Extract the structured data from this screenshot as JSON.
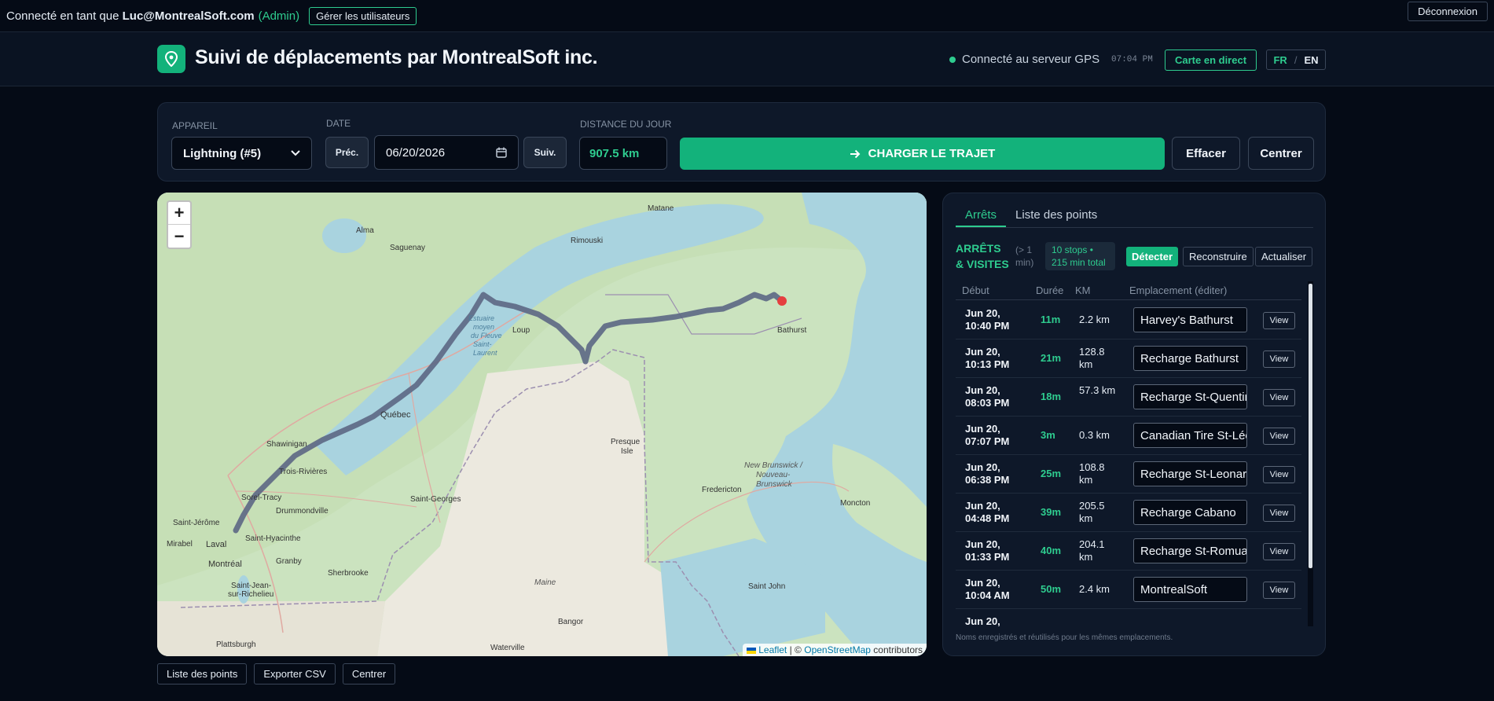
{
  "topbar": {
    "connected_prefix": "Connecté en tant que",
    "user_email": "Luc@MontrealSoft.com",
    "role": "(Admin)",
    "manage_users": "Gérer les utilisateurs",
    "logout": "Déconnexion"
  },
  "header": {
    "title": "Suivi de déplacements par MontrealSoft inc.",
    "gps_status": "Connecté au serveur GPS",
    "gps_time": "07:04 PM",
    "live_map": "Carte en direct",
    "lang_fr": "FR",
    "lang_sep": "/",
    "lang_en": "EN"
  },
  "controls": {
    "device_label": "APPAREIL",
    "device_value": "Lightning (#5)",
    "date_label": "DATE",
    "prev": "Préc.",
    "date_value": "06/20/2026",
    "next": "Suiv.",
    "distance_label": "DISTANCE DU JOUR",
    "distance_value": "907.5 km",
    "load": "CHARGER LE TRAJET",
    "clear": "Effacer",
    "center": "Centrer"
  },
  "map": {
    "labels": [
      "Matane",
      "Alma",
      "Saguenay",
      "Rimouski",
      "Estuaire",
      "moyen",
      "du Fleuve",
      "Saint-",
      "Laurent",
      "Loup",
      "Bathurst",
      "Québec",
      "Shawinigan",
      "Trois-Rivières",
      "Sorel-Tracy",
      "Drummondville",
      "Saint-Georges",
      "Presque",
      "Isle",
      "New Brunswick /",
      "Nouveau-",
      "Brunswick",
      "Fredericton",
      "Moncton",
      "Saint-Jérôme",
      "Mirabel",
      "Laval",
      "Saint-Hyacinthe",
      "Montréal",
      "Granby",
      "Sherbrooke",
      "Saint-Jean-",
      "sur-Richelieu",
      "Maine",
      "Saint John",
      "Bangor",
      "Plattsburgh",
      "Waterville"
    ],
    "zoom_in": "+",
    "zoom_out": "−",
    "attrib_leaflet": "Leaflet",
    "attrib_sep": "| ©",
    "attrib_osm": "OpenStreetMap",
    "attrib_contrib": "contributors"
  },
  "bottom": {
    "points_list": "Liste des points",
    "export_csv": "Exporter CSV",
    "center": "Centrer"
  },
  "panel": {
    "tab_stops": "Arrêts",
    "tab_points": "Liste des points",
    "stops_title": "ARRÊTS & VISITES",
    "stops_min": "(> 1 min)",
    "stops_summary": "10 stops • 215 min total",
    "detect": "Détecter",
    "rebuild": "Reconstruire",
    "refresh": "Actualiser",
    "col_start": "Début",
    "col_duration": "Durée",
    "col_km": "KM",
    "col_location": "Emplacement (éditer)",
    "view_label": "View",
    "rows": [
      {
        "start": "Jun 20, 10:40 PM",
        "duration": "11m",
        "km": "2.2 km",
        "location": "Harvey's Bathurst"
      },
      {
        "start": "Jun 20, 10:13 PM",
        "duration": "21m",
        "km": "128.8 km",
        "location": "Recharge Bathurst"
      },
      {
        "start": "Jun 20, 08:03 PM",
        "duration": "18m",
        "km": "57.3 km",
        "location": "Recharge St-Quentin"
      },
      {
        "start": "Jun 20, 07:07 PM",
        "duration": "3m",
        "km": "0.3 km",
        "location": "Canadian Tire St-Léonard"
      },
      {
        "start": "Jun 20, 06:38 PM",
        "duration": "25m",
        "km": "108.8 km",
        "location": "Recharge St-Leonard"
      },
      {
        "start": "Jun 20, 04:48 PM",
        "duration": "39m",
        "km": "205.5 km",
        "location": "Recharge Cabano"
      },
      {
        "start": "Jun 20, 01:33 PM",
        "duration": "40m",
        "km": "204.1 km",
        "location": "Recharge St-Romuald"
      },
      {
        "start": "Jun 20, 10:04 AM",
        "duration": "50m",
        "km": "2.4 km",
        "location": "MontrealSoft"
      },
      {
        "start": "Jun 20,",
        "duration": "",
        "km": "",
        "location": ""
      }
    ],
    "note": "Noms enregistrés et réutilisés pour les mêmes emplacements."
  }
}
